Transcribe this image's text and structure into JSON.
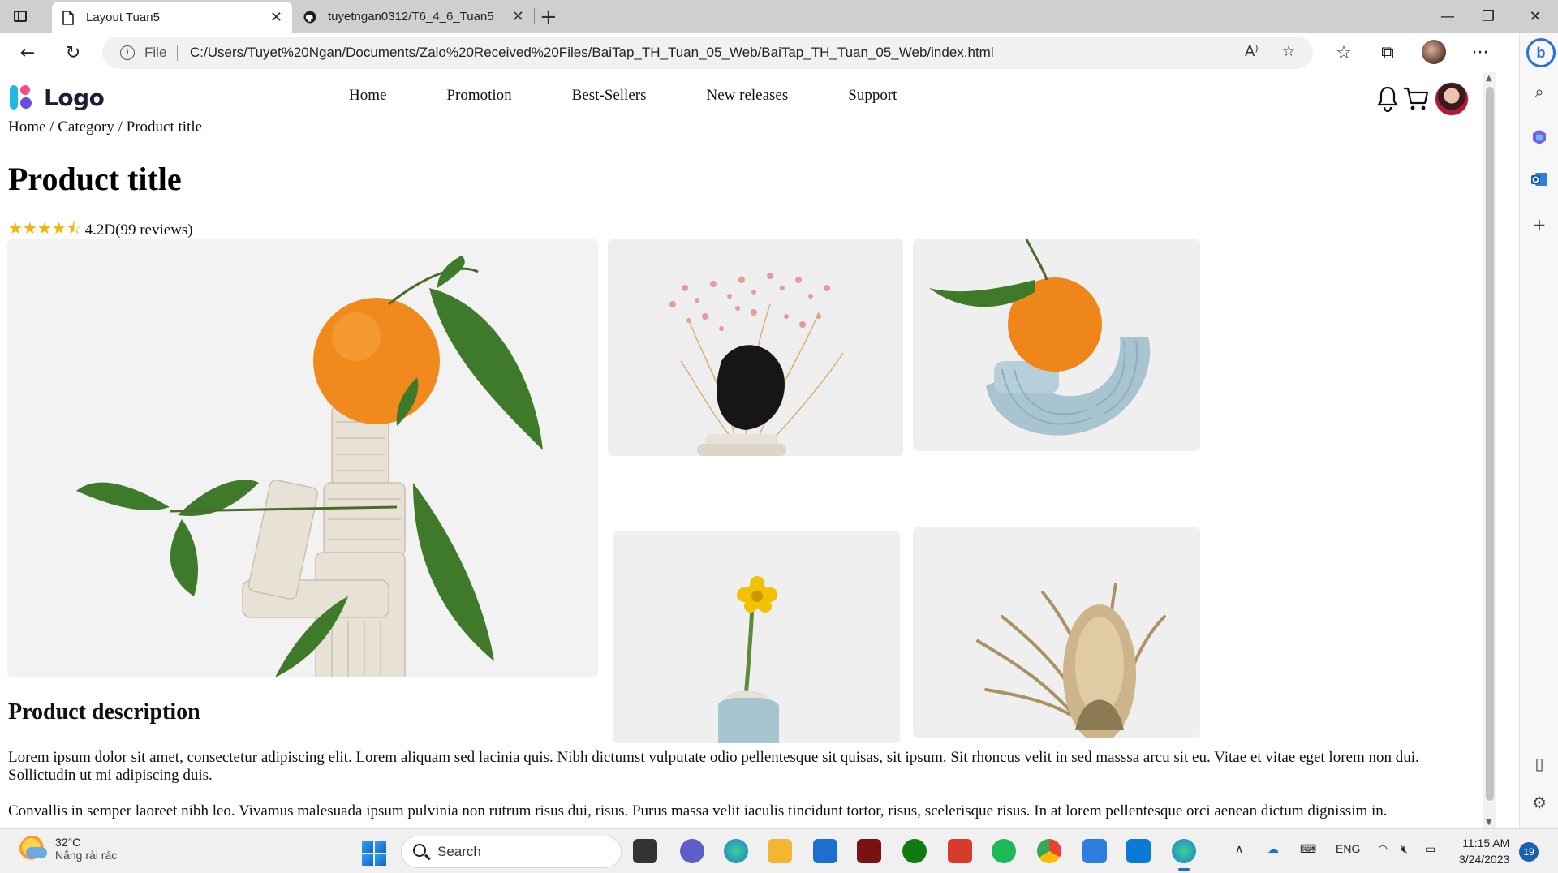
{
  "browser": {
    "tabs": [
      {
        "title": "Layout Tuan5",
        "active": true,
        "icon": "page-icon"
      },
      {
        "title": "tuyetngan0312/T6_4_6_Tuan5",
        "active": false,
        "icon": "github-icon"
      }
    ],
    "address": {
      "scheme_label": "File",
      "url": "C:/Users/Tuyet%20Ngan/Documents/Zalo%20Received%20Files/BaiTap_TH_Tuan_05_Web/BaiTap_TH_Tuan_05_Web/index.html"
    }
  },
  "site": {
    "logo_text": "Logo",
    "nav": [
      "Home",
      "Promotion",
      "Best-Sellers",
      "New releases",
      "Support"
    ],
    "breadcrumb": "Home / Category / Product title",
    "product_title": "Product title",
    "rating": {
      "stars": "★★★★⯪",
      "text": "4.2D(99 reviews)",
      "value": 4.2
    },
    "description_title": "Product description",
    "paragraphs": [
      "Lorem ipsum dolor sit amet, consectetur adipiscing elit. Lorem aliquam sed lacinia quis. Nibh dictumst vulputate odio pellentesque sit quisas, sit ipsum. Sit rhoncus velit in sed masssa arcu sit eu. Vitae et vitae eget lorem non dui. Sollictudin ut mi adipiscing duis.",
      "Convallis in semper laoreet nibh leo. Vivamus malesuada ipsum pulvinia non rutrum risus dui, risus. Purus massa velit iaculis tincidunt tortor, risus, scelerisque risus. In at lorem pellentesque orci aenean dictum dignissim in."
    ]
  },
  "taskbar": {
    "weather_temp": "32°C",
    "weather_desc": "Nắng rải rác",
    "search_label": "Search",
    "lang": "ENG",
    "time": "11:15 AM",
    "date": "3/24/2023",
    "notifications": "19"
  },
  "colors": {
    "star": "#f4b400",
    "orange": "#f08a1c",
    "leaf": "#3f7a2a",
    "accent": "#1f6fd9"
  }
}
